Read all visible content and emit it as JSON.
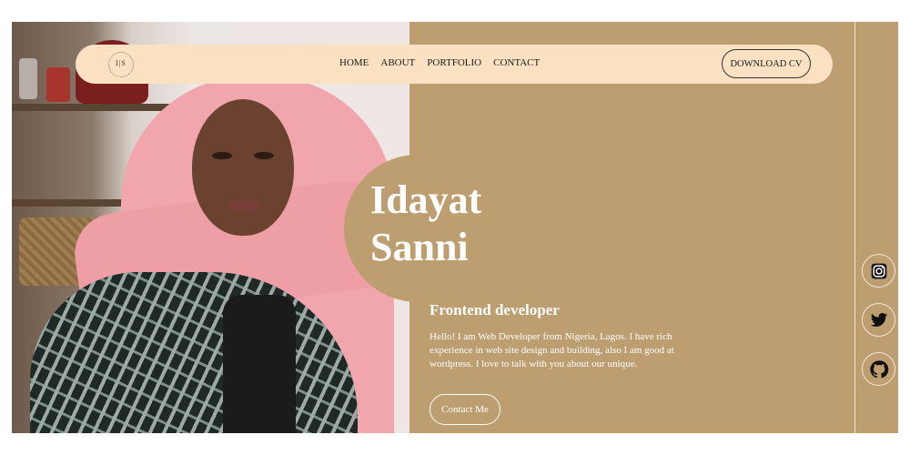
{
  "logo": {
    "text": "I|S"
  },
  "nav": {
    "home": "HOME",
    "about": "ABOUT",
    "portfolio": "PORTFOLIO",
    "contact": "CONTACT"
  },
  "download_cv": "DOWNLOAD CV",
  "hero": {
    "first_name": "Idayat",
    "last_name": "Sanni",
    "role": "Frontend developer",
    "bio": "Hello! I am Web Developer from Nigeria, Lagos. I have rich experience in web site design and building, also I am good at wordpress. I love to talk with you about our unique.",
    "contact_label": "Contact Me"
  },
  "social": [
    "instagram-icon",
    "twitter-icon",
    "github-icon"
  ],
  "colors": {
    "accent": "#bc9e70",
    "nav_bg": "#f9e1c2",
    "hijab": "#f0a6ac",
    "text_light": "#ffffff"
  }
}
